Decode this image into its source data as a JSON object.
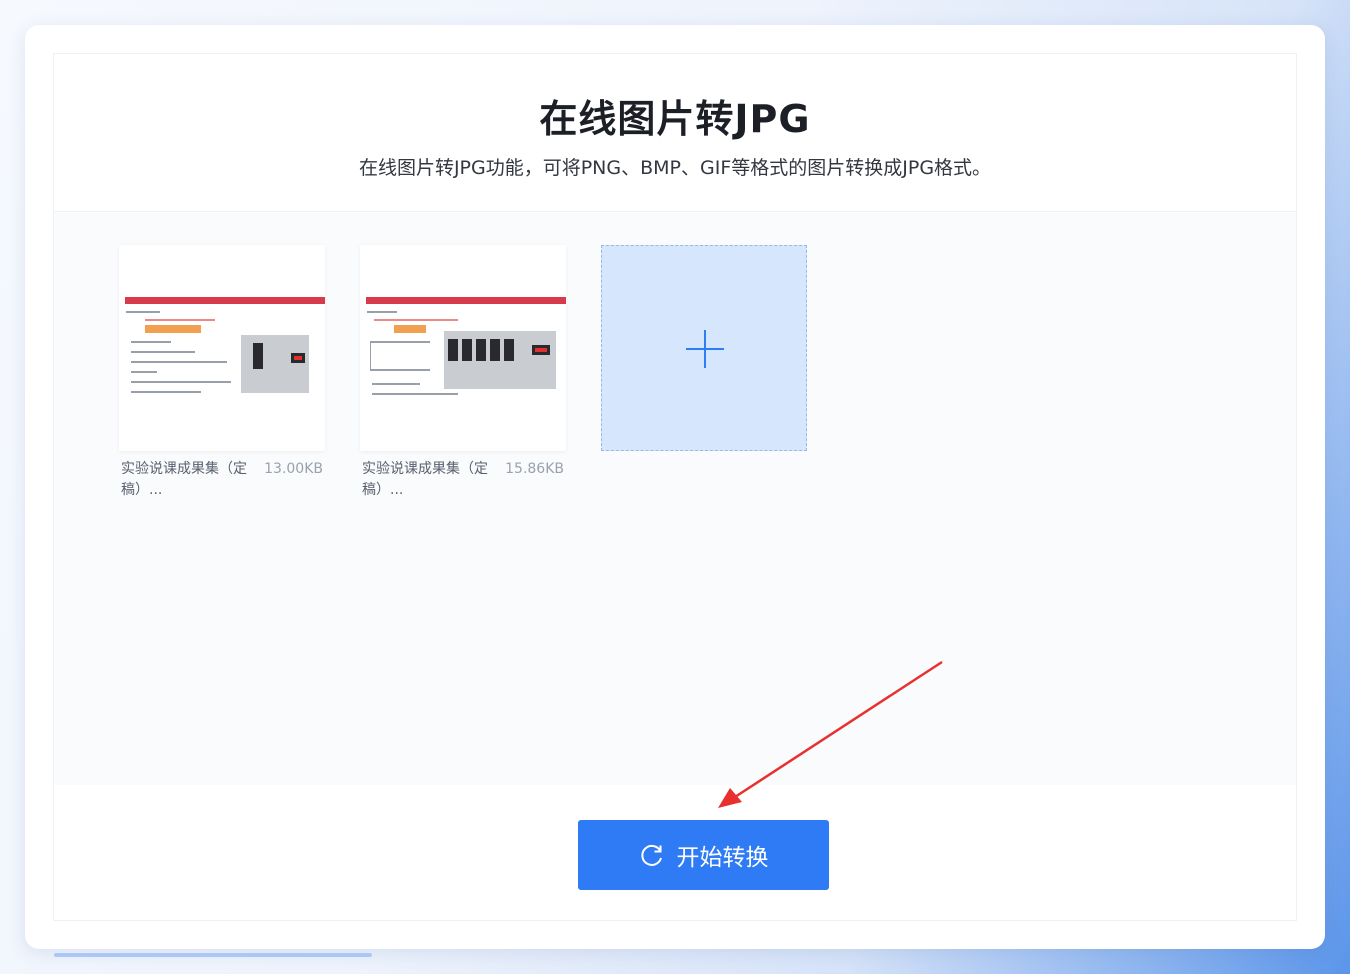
{
  "header": {
    "title": "在线图片转JPG",
    "subtitle": "在线图片转JPG功能，可将PNG、BMP、GIF等格式的图片转换成JPG格式。"
  },
  "files": [
    {
      "name": "实验说课成果集（定稿）...",
      "size": "13.00KB"
    },
    {
      "name": "实验说课成果集（定稿）...",
      "size": "15.86KB"
    }
  ],
  "add_tile": {
    "icon": "plus-icon"
  },
  "actions": {
    "start_label": "开始转换",
    "start_icon": "refresh-icon"
  },
  "colors": {
    "accent": "#2f7bf5",
    "arrow": "#e8302f",
    "add_tile_bg": "#d6e6fd"
  }
}
